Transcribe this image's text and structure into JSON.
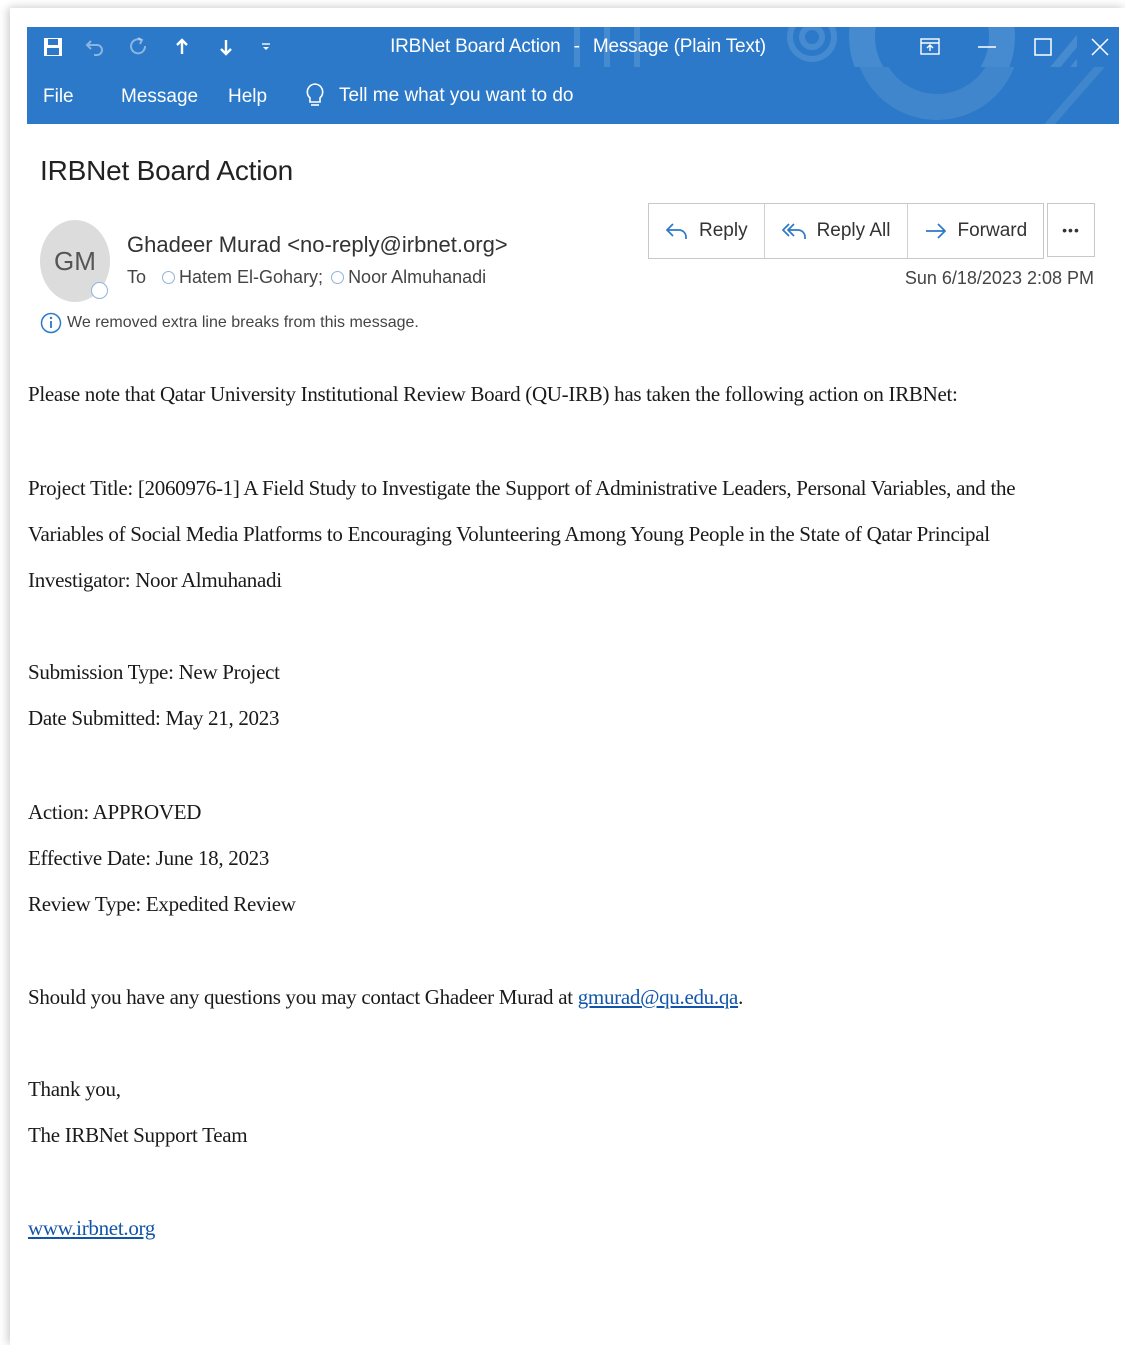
{
  "window": {
    "title": "IRBNet Board Action",
    "separator": "-",
    "mode": "Message (Plain Text)"
  },
  "menu": {
    "file": "File",
    "message": "Message",
    "help": "Help",
    "tell_me": "Tell me what you want to do"
  },
  "icons": {
    "save": "save-icon",
    "undo": "undo-icon",
    "redo": "redo-icon",
    "up": "arrow-up-icon",
    "down": "arrow-down-icon",
    "customize": "customize-quick-access-icon",
    "restore": "ribbon-display-icon",
    "minimize": "minimize-icon",
    "maximize": "maximize-icon",
    "close": "close-icon",
    "lightbulb": "lightbulb-icon",
    "info": "info-icon"
  },
  "colors": {
    "titlebar": "#2b79c8",
    "link": "#1155aa"
  },
  "header": {
    "subject": "IRBNet Board Action",
    "avatar_initials": "GM",
    "sender": "Ghadeer Murad <no-reply@irbnet.org>",
    "to_label": "To",
    "recipients": [
      "Hatem El-Gohary;",
      "Noor Almuhanadi"
    ],
    "datetime": "Sun 6/18/2023 2:08 PM",
    "info_notice": "We removed extra line breaks from this message."
  },
  "actions": {
    "reply": "Reply",
    "reply_all": "Reply All",
    "forward": "Forward",
    "more": "•••"
  },
  "body": {
    "intro": "Please note that Qatar University Institutional Review Board (QU-IRB) has taken the following action on IRBNet:",
    "project_line1": "Project Title: [2060976-1] A Field Study to Investigate the Support of Administrative Leaders, Personal Variables, and the",
    "project_line2": "Variables of Social Media Platforms to Encouraging Volunteering Among Young People in the State of Qatar Principal",
    "project_line3": "Investigator: Noor Almuhanadi",
    "submission_type": "Submission Type: New Project",
    "date_submitted": "Date Submitted: May 21, 2023",
    "action": "Action: APPROVED",
    "effective_date": "Effective Date: June 18, 2023",
    "review_type": "Review Type: Expedited Review",
    "contact_prefix": "Should you have any questions you may contact Ghadeer Murad at ",
    "contact_email": "gmurad@qu.edu.qa",
    "contact_suffix": ".",
    "thanks": "Thank you,",
    "team": "The IRBNet Support Team",
    "website": "www.irbnet.org"
  }
}
